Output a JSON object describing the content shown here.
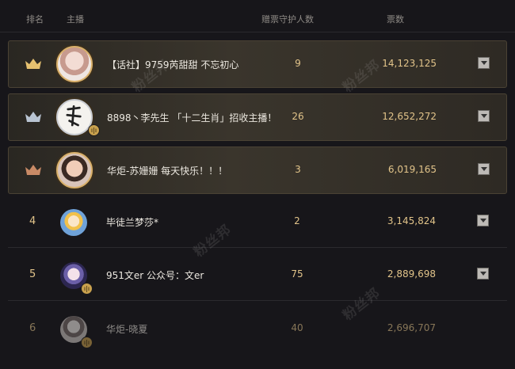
{
  "header": {
    "rank_label": "排名",
    "anchor_label": "主播",
    "guards_label": "赠票守护人数",
    "votes_label": "票数"
  },
  "rows": [
    {
      "rank": "1",
      "crown": "gold-crown-icon",
      "name": "【话社】9759芮甜甜 不忘初心",
      "guards": "9",
      "votes": "14,123,125",
      "avatar": "female-avatar"
    },
    {
      "rank": "2",
      "crown": "silver-crown-icon",
      "name": "8898丶李先生 「十二生肖」招收主播！",
      "guards": "26",
      "votes": "12,652,272",
      "avatar": "calligraphy-avatar"
    },
    {
      "rank": "3",
      "crown": "bronze-crown-icon",
      "name": "华炬-苏姗姗 每天快乐！！！",
      "guards": "3",
      "votes": "6,019,165",
      "avatar": "female-avatar"
    },
    {
      "rank": "4",
      "name": "毕徒兰梦莎*",
      "guards": "2",
      "votes": "3,145,824",
      "avatar": "anime-avatar"
    },
    {
      "rank": "5",
      "name": "951文er 公众号：文er",
      "guards": "75",
      "votes": "2,889,698",
      "avatar": "female-avatar"
    },
    {
      "rank": "6",
      "name": "华炬-晓夏",
      "guards": "40",
      "votes": "2,696,707",
      "avatar": "female-avatar"
    }
  ],
  "watermark": "粉丝邦",
  "colors": {
    "gold": "#e2c48a",
    "background": "#17161a"
  }
}
